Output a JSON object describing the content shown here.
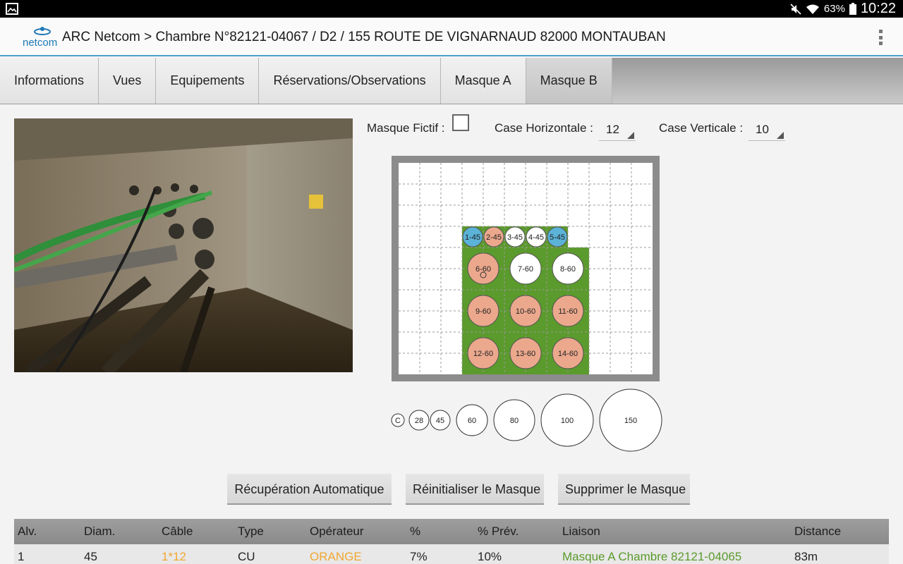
{
  "status_bar": {
    "battery": "63%",
    "time": "10:22"
  },
  "header": {
    "title": "ARC Netcom > Chambre N°82121-04067 / D2 / 155 ROUTE DE VIGNARNAUD 82000 MONTAUBAN",
    "logo_text": "netcom"
  },
  "tabs": [
    {
      "label": "Informations"
    },
    {
      "label": "Vues"
    },
    {
      "label": "Equipements"
    },
    {
      "label": "Réservations/Observations"
    },
    {
      "label": "Masque A"
    },
    {
      "label": "Masque B",
      "selected": true
    }
  ],
  "controls": {
    "masque_fictif_label": "Masque Fictif :",
    "masque_fictif_checked": false,
    "case_horizontale_label": "Case Horizontale :",
    "case_horizontale_value": "12",
    "case_verticale_label": "Case Verticale :",
    "case_verticale_value": "10"
  },
  "mask": {
    "cols": 12,
    "rows": 10,
    "colors": {
      "green": "#5b9a2c",
      "salmon": "#eba88d",
      "blue": "#5bb3d8",
      "white": "#ffffff"
    },
    "alveoles": [
      {
        "label": "1-45",
        "color": "blue"
      },
      {
        "label": "2-45",
        "color": "salmon"
      },
      {
        "label": "3-45",
        "color": "white"
      },
      {
        "label": "4-45",
        "color": "white"
      },
      {
        "label": "5-45",
        "color": "blue"
      },
      {
        "label": "6-60",
        "color": "salmon"
      },
      {
        "label": "7-60",
        "color": "white"
      },
      {
        "label": "8-60",
        "color": "white"
      },
      {
        "label": "9-60",
        "color": "salmon"
      },
      {
        "label": "10-60",
        "color": "salmon"
      },
      {
        "label": "11-60",
        "color": "salmon"
      },
      {
        "label": "12-60",
        "color": "salmon"
      },
      {
        "label": "13-60",
        "color": "salmon"
      },
      {
        "label": "14-60",
        "color": "salmon"
      }
    ]
  },
  "palette": [
    {
      "label": "C"
    },
    {
      "label": "28"
    },
    {
      "label": "45"
    },
    {
      "label": "60"
    },
    {
      "label": "80"
    },
    {
      "label": "100"
    },
    {
      "label": "150"
    }
  ],
  "buttons": {
    "auto": "Récupération Automatique",
    "reset": "Réinitialiser le Masque",
    "delete": "Supprimer le Masque"
  },
  "table": {
    "headers": [
      "Alv.",
      "Diam.",
      "Câble",
      "Type",
      "Opérateur",
      "%",
      "% Prév.",
      "Liaison",
      "Distance"
    ],
    "rows": [
      [
        "1",
        "45",
        "1*12",
        "CU",
        "ORANGE",
        "7%",
        "10%",
        "Masque A Chambre 82121-04065",
        "83m"
      ]
    ],
    "colors": {
      "cable": "#f0a830",
      "operator": "#f0a830",
      "liaison": "#5b9a2c"
    }
  }
}
